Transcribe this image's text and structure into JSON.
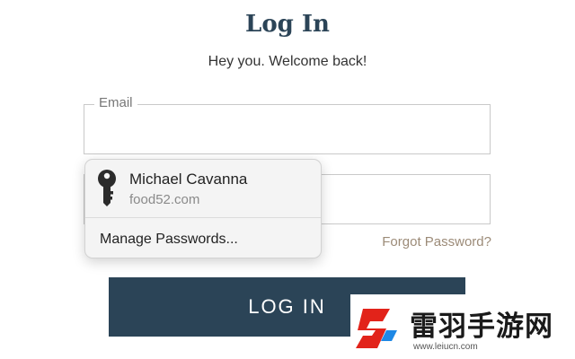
{
  "header": {
    "title": "Log In",
    "subtitle": "Hey you. Welcome back!"
  },
  "form": {
    "email_label": "Email",
    "email_value": "",
    "password_value": "",
    "forgot_link": "Forgot Password?",
    "submit_label": "LOG IN"
  },
  "autofill_popup": {
    "entry_name": "Michael Cavanna",
    "entry_site": "food52.com",
    "manage_label": "Manage Passwords...",
    "icon": "key-icon"
  },
  "watermark": {
    "text": "雷羽手游网",
    "url": "www.leiucn.com"
  },
  "colors": {
    "brand": "#2b4457",
    "link": "#9c8b78",
    "popup_bg": "#f4f4f4"
  }
}
